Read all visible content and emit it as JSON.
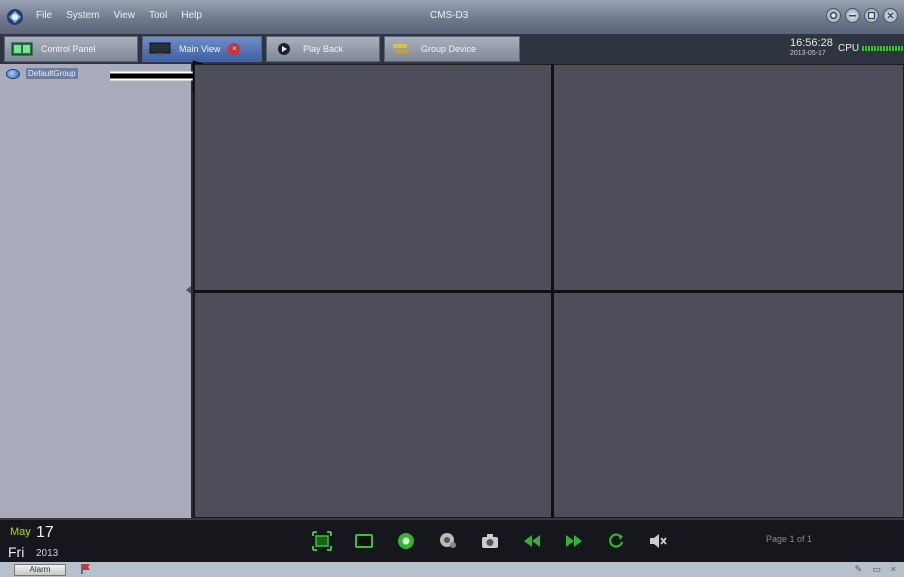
{
  "app": {
    "title": "CMS-D3"
  },
  "menu": {
    "items": [
      "File",
      "System",
      "View",
      "Tool",
      "Help"
    ]
  },
  "window_controls": [
    "settings",
    "minimize",
    "maximize",
    "close"
  ],
  "tabs": [
    {
      "label": "Control Panel",
      "active": false
    },
    {
      "label": "Main View",
      "active": true
    },
    {
      "label": "Play Back",
      "active": false
    },
    {
      "label": "Group Device",
      "active": false
    }
  ],
  "clock": {
    "time": "16:56:28",
    "date": "2013-05-17"
  },
  "cpu": {
    "label": "CPU"
  },
  "sidebar": {
    "tree": [
      {
        "label": "DefaultGroup"
      }
    ]
  },
  "date_panel": {
    "month": "May",
    "day": "17",
    "weekday": "Fri",
    "year": "2013"
  },
  "controls": [
    "fullscreen-icon",
    "single-view-icon",
    "record-icon",
    "preset-icon",
    "snapshot-icon",
    "previous-page-icon",
    "next-page-icon",
    "refresh-icon",
    "mute-icon"
  ],
  "page_info": "Page 1 of 1",
  "status": {
    "alarm_label": "Alarm"
  },
  "colors": {
    "accent_green": "#2fb52f",
    "tab_active": "#3e5fa2",
    "close_red": "#d43030"
  }
}
